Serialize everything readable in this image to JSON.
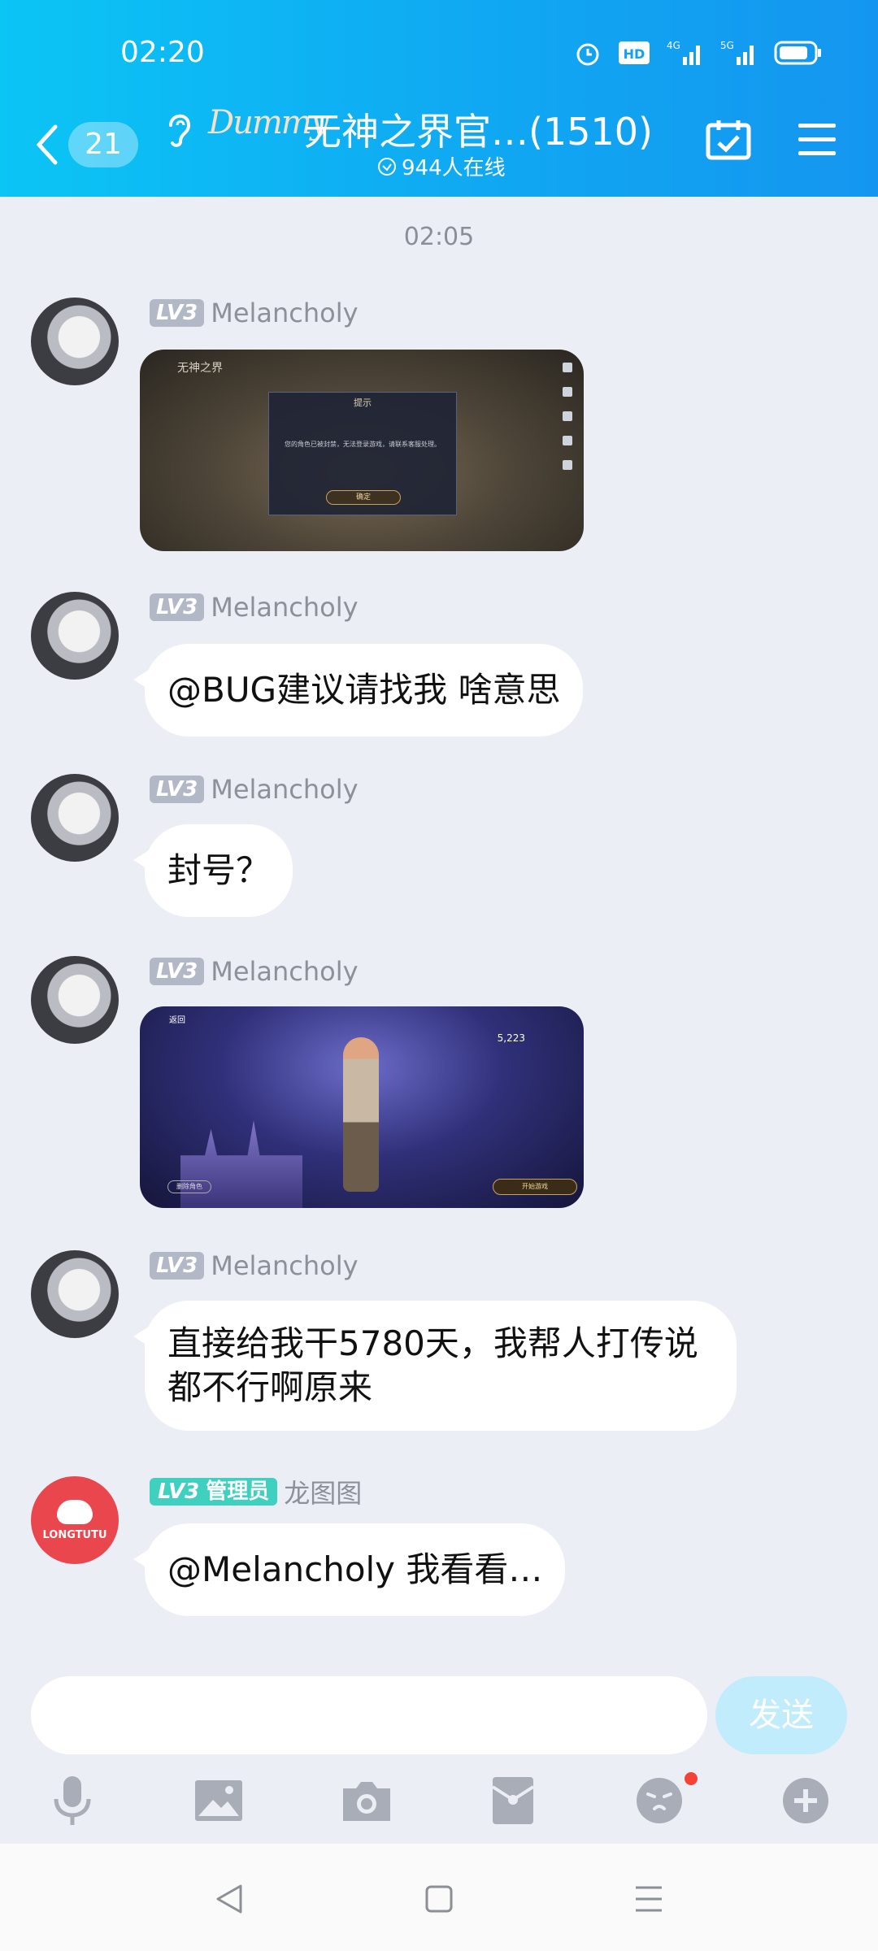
{
  "status_bar": {
    "time": "02:20",
    "network_labels": [
      "HD",
      "4G",
      "5G"
    ]
  },
  "header": {
    "unread_count": "21",
    "logo_text": "Dummy",
    "title": "无神之界官…(1510)",
    "online_text": "944人在线"
  },
  "chat": {
    "timestamp": "02:05",
    "messages": [
      {
        "level": "LV3",
        "sender": "Melancholy",
        "type": "image",
        "image": {
          "dialog_title": "提示",
          "dialog_text": "您的角色已被封禁，无法登录游戏，请联系客服处理。",
          "dialog_button": "确定",
          "corner_logo": "无神之界"
        }
      },
      {
        "level": "LV3",
        "sender": "Melancholy",
        "type": "text",
        "text": "@BUG建议请找我 啥意思"
      },
      {
        "level": "LV3",
        "sender": "Melancholy",
        "type": "text",
        "text": "封号？"
      },
      {
        "level": "LV3",
        "sender": "Melancholy",
        "type": "image",
        "image": {
          "back_label": "返回",
          "score": "5,223",
          "left_button": "删除角色",
          "right_button": "开始游戏"
        }
      },
      {
        "level": "LV3",
        "sender": "Melancholy",
        "type": "text",
        "text": "直接给我干5780天，我帮人打传说都不行啊原来"
      },
      {
        "level": "LV3",
        "role": "管理员",
        "sender": "龙图图",
        "avatar_text": "LONGTUTU",
        "type": "text",
        "text": "@Melancholy 我看看…"
      }
    ]
  },
  "composer": {
    "input_value": "",
    "send_label": "发送"
  },
  "toolbar": {
    "icons": [
      "microphone-icon",
      "image-icon",
      "camera-icon",
      "red-packet-icon",
      "emoji-icon",
      "plus-icon"
    ],
    "emoji_has_badge": true
  },
  "navbar": {
    "icons": [
      "back-triangle-icon",
      "home-square-icon",
      "menu-icon"
    ]
  },
  "colors": {
    "header_start": "#0bc5f5",
    "header_end": "#1496f0",
    "chat_bg": "#eceef5",
    "admin_badge": "#3fd0bf",
    "send_disabled": "#c1ecfb"
  }
}
